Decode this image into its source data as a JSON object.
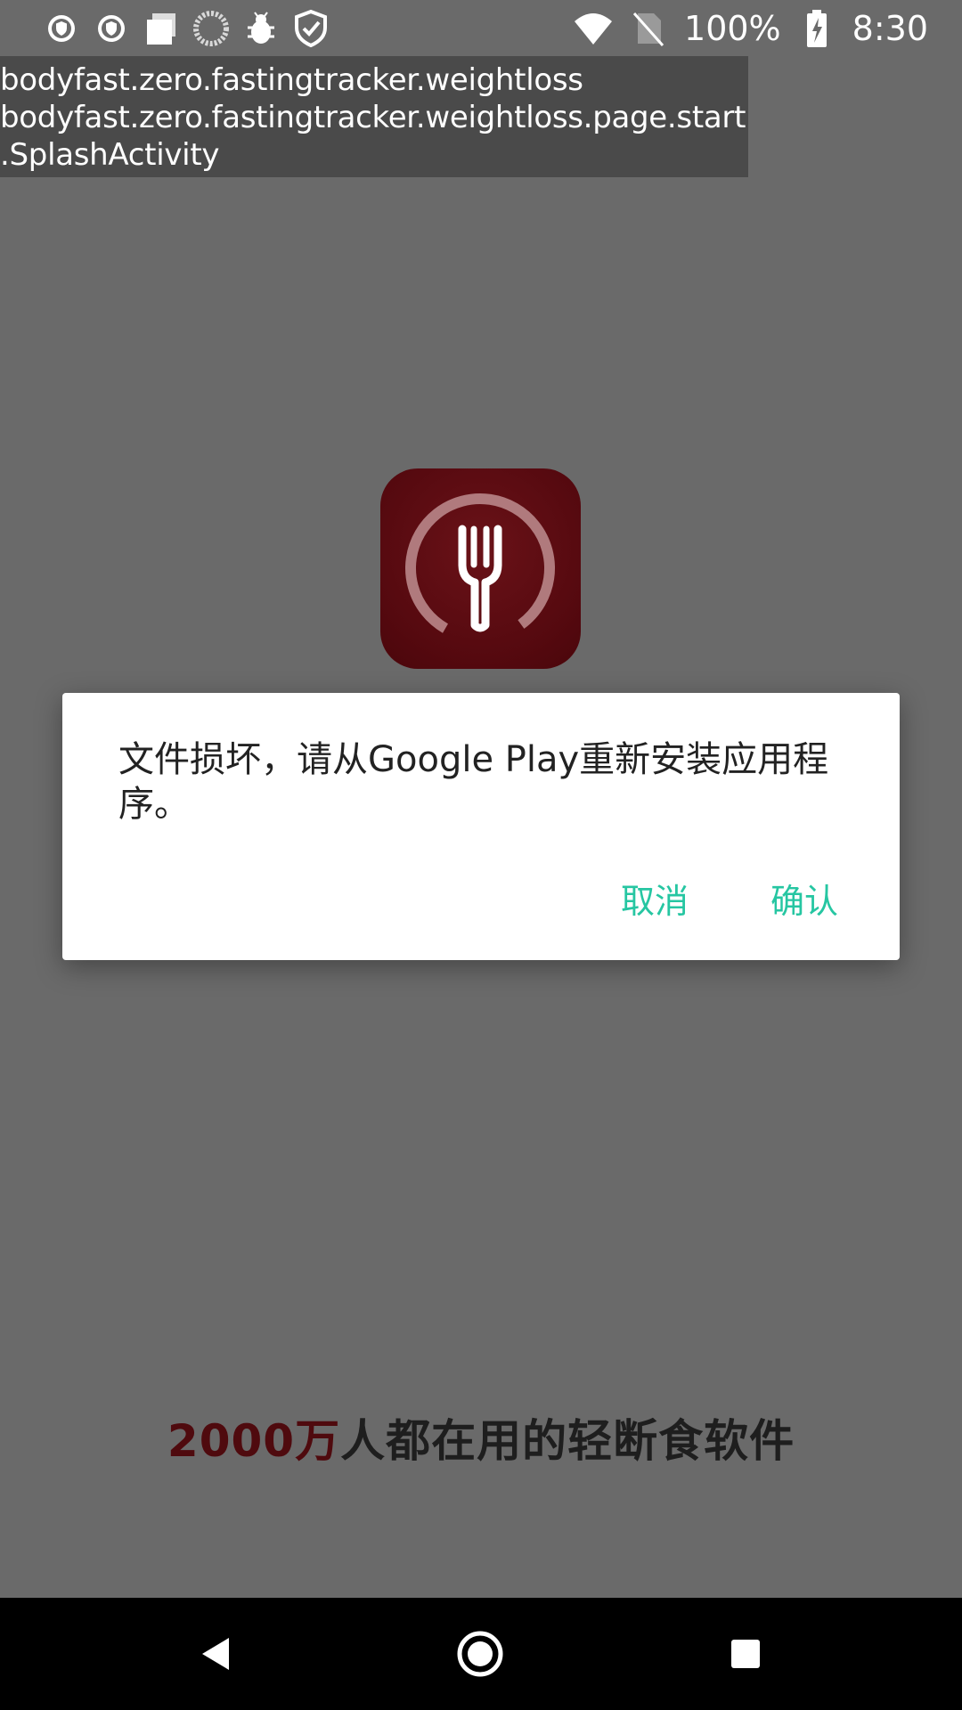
{
  "status_bar": {
    "left_icons": [
      "shield-badge-icon",
      "shield-badge-icon",
      "square-stack-icon",
      "loading-circle-icon",
      "bug-icon",
      "check-shield-icon"
    ],
    "battery_percent": "100%",
    "time": "8:30",
    "right_icons": [
      "wifi-icon",
      "no-sim-icon",
      "battery-charging-icon"
    ]
  },
  "activity_overlay": {
    "lines": [
      "bodyfast.zero.fastingtracker.weightloss",
      "bodyfast.zero.fastingtracker.weightloss.page.start",
      ".SplashActivity"
    ]
  },
  "app_icon": {
    "name": "fork-timer-icon",
    "background": "#55090f"
  },
  "dialog": {
    "message": "文件损坏，请从Google Play重新安装应用程序。",
    "cancel_label": "取消",
    "confirm_label": "确认",
    "accent_color": "#26c6a2"
  },
  "tagline": {
    "highlight": "2000万",
    "rest": "人都在用的轻断食软件"
  },
  "nav_bar": {
    "icons": [
      "back-icon",
      "home-icon",
      "recents-icon"
    ]
  }
}
